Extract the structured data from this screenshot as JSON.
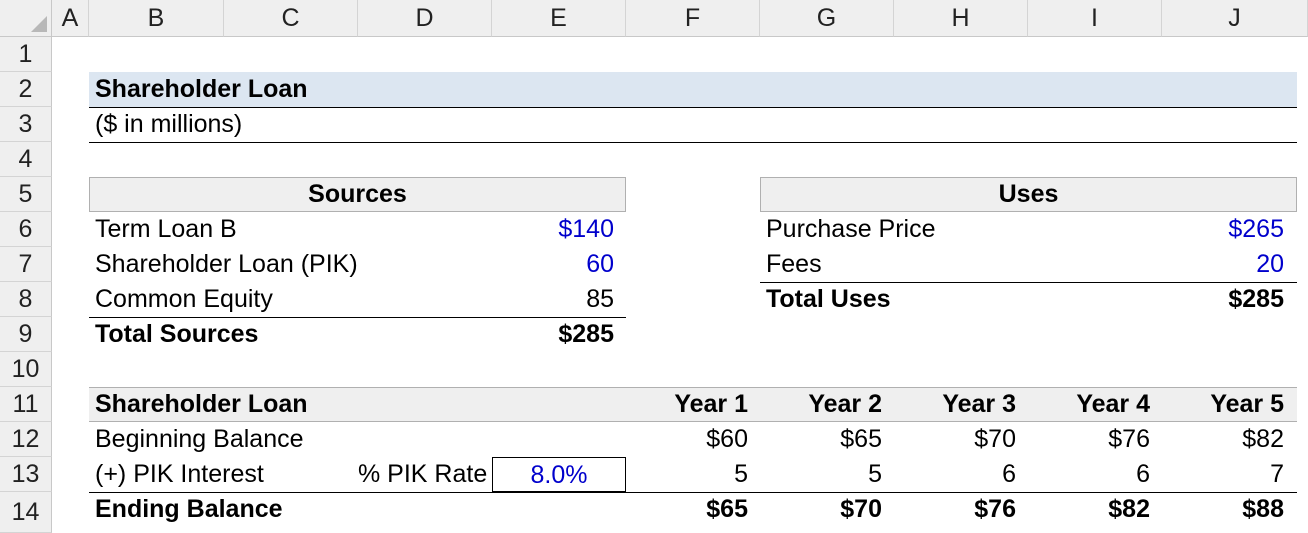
{
  "columns": [
    "A",
    "B",
    "C",
    "D",
    "E",
    "F",
    "G",
    "H",
    "I",
    "J"
  ],
  "rows": [
    "1",
    "2",
    "3",
    "4",
    "5",
    "6",
    "7",
    "8",
    "9",
    "10",
    "11",
    "12",
    "13",
    "14"
  ],
  "title": "Shareholder Loan",
  "subtitle": "($ in millions)",
  "sources": {
    "header": "Sources",
    "items": [
      {
        "label": "Term Loan B",
        "value": "$140"
      },
      {
        "label": "Shareholder Loan (PIK)",
        "value": "60"
      },
      {
        "label": "Common Equity",
        "value": "85"
      }
    ],
    "total_label": "Total Sources",
    "total_value": "$285"
  },
  "uses": {
    "header": "Uses",
    "items": [
      {
        "label": "Purchase Price",
        "value": "$265"
      },
      {
        "label": "Fees",
        "value": "20"
      }
    ],
    "total_label": "Total Uses",
    "total_value": "$285"
  },
  "schedule": {
    "header": "Shareholder Loan",
    "years": [
      "Year 1",
      "Year 2",
      "Year 3",
      "Year 4",
      "Year 5"
    ],
    "beginning_label": "Beginning Balance",
    "beginning": [
      "$60",
      "$65",
      "$70",
      "$76",
      "$82"
    ],
    "pik_label": "(+) PIK Interest",
    "pik_rate_label": "% PIK Rate",
    "pik_rate": "8.0%",
    "pik": [
      "5",
      "5",
      "6",
      "6",
      "7"
    ],
    "ending_label": "Ending Balance",
    "ending": [
      "$65",
      "$70",
      "$76",
      "$82",
      "$88"
    ]
  },
  "colors": {
    "input_blue": "#0000cc",
    "header_fill": "#dce6f1",
    "table_header_fill": "#efefef"
  }
}
